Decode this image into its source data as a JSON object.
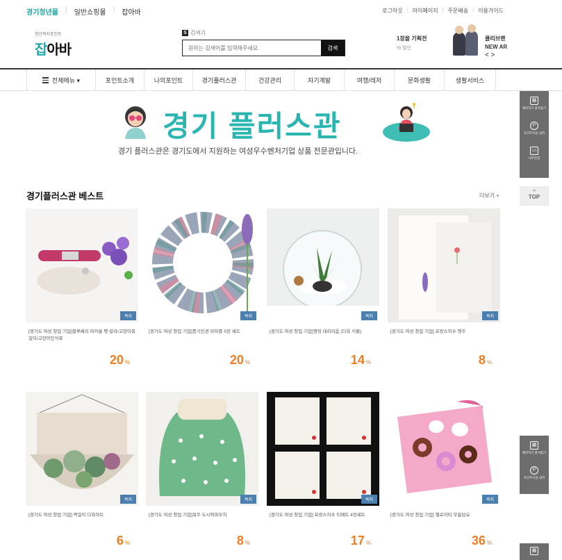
{
  "topbar": {
    "tabs": [
      "경기청년몰",
      "일반쇼핑몰",
      "잡아바"
    ],
    "links": [
      "로그아웃",
      "마이페이지",
      "주문배송",
      "이용가이드"
    ]
  },
  "header": {
    "logo_sub": "청년복지포인트",
    "logo_main_accent": "잡",
    "logo_main_rest": "아바",
    "search_tag_letter": "S",
    "search_tag": "검색기",
    "search_placeholder": "원하는 검색어를 입력해주세요.",
    "search_button": "검색",
    "promo1_title": "1장을 기획전",
    "promo1_sub": "% 할인",
    "promo2_title": "클리브랜",
    "promo2_sub": "NEW AR",
    "promo2_arrows": "< >"
  },
  "nav": {
    "items": [
      "전체메뉴 ▾",
      "포인트소개",
      "나의포인트",
      "경기플러스관",
      "건강관리",
      "자기계발",
      "여행/레저",
      "문화생활",
      "생활서비스"
    ]
  },
  "banner": {
    "title": "경기 플러스관",
    "description": "경기 플러스관은 경기도에서 지원하는 여성우수벤처기업 상품 전문관입니다."
  },
  "section": {
    "title": "경기플러스관 베스트",
    "more": "더보기 +"
  },
  "products": [
    {
      "badge": "복지",
      "name": "[경기도 여성 창업 기업]블루베리 마카롱 펫 칼라/고양이목걸이/고양이인식표",
      "discount": "20",
      "unit": "%"
    },
    {
      "badge": "복지",
      "name": "[경기도 여성 창업 기업]풍기인견 마하를 5장 세트",
      "discount": "20",
      "unit": "%"
    },
    {
      "badge": "복지",
      "name": "[경기도 여성 창업 기업]행잉 테라리움 (다육 식물)",
      "discount": "14",
      "unit": "%"
    },
    {
      "badge": "복지",
      "name": "[경기도 여성 창업 기업] 프랑스자수 행주",
      "discount": "8",
      "unit": "%"
    },
    {
      "badge": "복지",
      "name": "[경기도 여성 창업 기업] 벽걸이 다육아트",
      "discount": "6",
      "unit": "%"
    },
    {
      "badge": "복지",
      "name": "[경기도 여성 창업 기업]복주 도시락파우치",
      "discount": "8",
      "unit": "%"
    },
    {
      "badge": "복지",
      "name": "[경기도 여성 창업 기업] 프랑스자수 티매트 4장세트",
      "discount": "17",
      "unit": "%"
    },
    {
      "badge": "복지",
      "name": "[경기도 여성 창업 기업] 헬로키티 무릎담요",
      "discount": "36",
      "unit": "%"
    }
  ],
  "side": {
    "item1": "예약하기 즐겨찾기",
    "item2": "포인트이용 내역",
    "item3": "내주문함",
    "top": "TOP",
    "item4": "예약하기 즐겨찾기",
    "item5": "포인트이용 내역"
  }
}
